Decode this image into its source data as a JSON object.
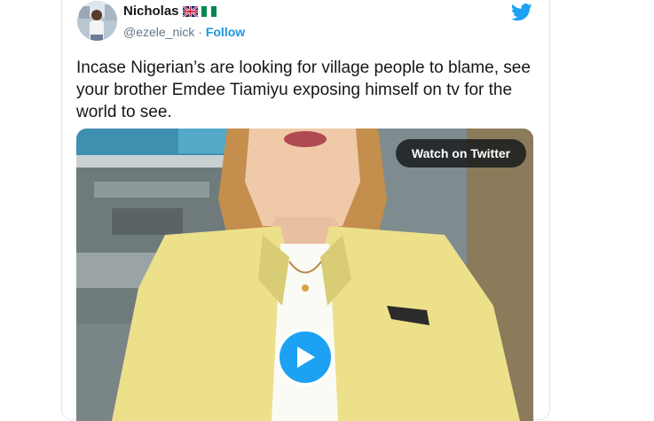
{
  "author": {
    "name": "Nicholas",
    "flags": [
      "uk-flag-icon",
      "nigeria-flag-icon"
    ],
    "handle": "@ezele_nick",
    "separator": " · ",
    "follow_label": "Follow"
  },
  "brand_icon": "twitter-bird-icon",
  "tweet": {
    "text": "Incase Nigerian’s are looking for village people to blame, see your brother Emdee Tiamiyu exposing himself on tv for the world to see."
  },
  "media": {
    "watch_label": "Watch on Twitter",
    "play_icon": "play-icon"
  },
  "colors": {
    "accent": "#1da1f2",
    "link": "#1b95e0",
    "text": "#14171a",
    "muted": "#657786"
  }
}
